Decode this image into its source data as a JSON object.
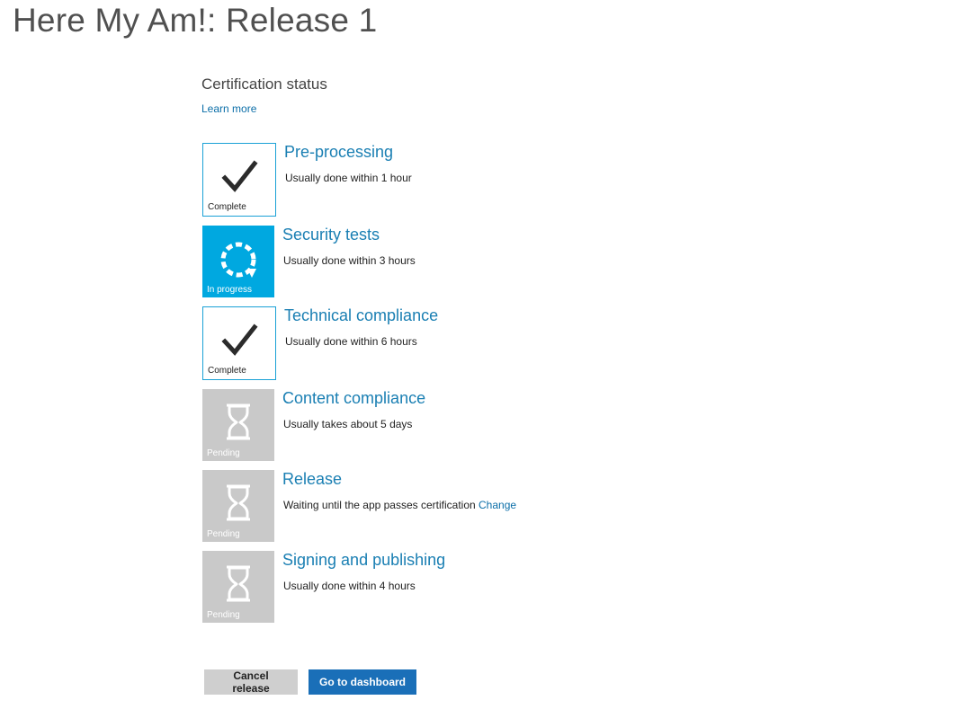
{
  "header": {
    "title": "Here My Am!: Release 1"
  },
  "certification": {
    "title": "Certification status",
    "learn_more": "Learn more"
  },
  "steps": [
    {
      "name": "Pre-processing",
      "description": "Usually done within 1 hour",
      "status": "Complete",
      "icon": "checkmark-icon"
    },
    {
      "name": "Security tests",
      "description": "Usually done within 3 hours",
      "status": "In progress",
      "icon": "refresh-icon"
    },
    {
      "name": "Technical compliance",
      "description": "Usually done within 6 hours",
      "status": "Complete",
      "icon": "checkmark-icon"
    },
    {
      "name": "Content compliance",
      "description": "Usually takes about 5 days",
      "status": "Pending",
      "icon": "hourglass-icon"
    },
    {
      "name": "Release",
      "description": "Waiting until the app passes certification",
      "link": "Change",
      "status": "Pending",
      "icon": "hourglass-icon"
    },
    {
      "name": "Signing and publishing",
      "description": "Usually done within 4 hours",
      "status": "Pending",
      "icon": "hourglass-icon"
    }
  ],
  "actions": {
    "cancel_label": "Cancel release",
    "dashboard_label": "Go to dashboard"
  },
  "colors": {
    "accent": "#00a8e0",
    "link": "#0b6ea8",
    "pending": "#c9c9c9",
    "primary_button": "#1a6fb8"
  }
}
